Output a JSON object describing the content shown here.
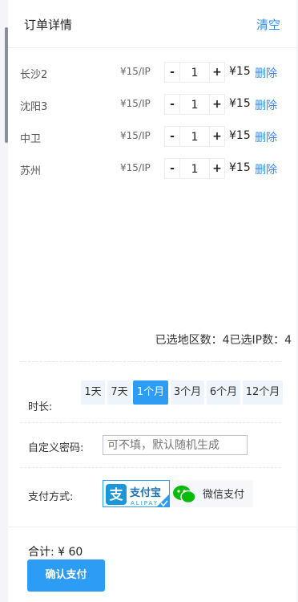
{
  "header": {
    "title": "订单详情",
    "clear_label": "清空"
  },
  "items": [
    {
      "city": "长沙2",
      "unit_price": "¥15/IP",
      "minus": "-",
      "quantity": "1",
      "plus": "+",
      "total": "¥15",
      "delete_label": "删除"
    },
    {
      "city": "沈阳3",
      "unit_price": "¥15/IP",
      "minus": "-",
      "quantity": "1",
      "plus": "+",
      "total": "¥15",
      "delete_label": "删除"
    },
    {
      "city": "中卫",
      "unit_price": "¥15/IP",
      "minus": "-",
      "quantity": "1",
      "plus": "+",
      "total": "¥15",
      "delete_label": "删除"
    },
    {
      "city": "苏州",
      "unit_price": "¥15/IP",
      "minus": "-",
      "quantity": "1",
      "plus": "+",
      "total": "¥15",
      "delete_label": "删除"
    }
  ],
  "summary": "已选地区数：4已选IP数：4",
  "duration": {
    "label": "时长:",
    "options": [
      "1天",
      "7天",
      "1个月",
      "3个月",
      "6个月",
      "12个月"
    ],
    "selected": "1个月"
  },
  "password": {
    "label": "自定义密码:",
    "placeholder": "可不填，默认随机生成"
  },
  "payment": {
    "label": "支付方式:",
    "alipay_char": "支",
    "alipay_name": "支付宝",
    "alipay_sub": "ALIPAY",
    "wechat_name": "微信支付",
    "selected": "alipay"
  },
  "footer": {
    "total": "合计: ¥ 60",
    "confirm_label": "确认支付"
  },
  "colors": {
    "accent": "#2d9cf5",
    "link": "#2d8cf0",
    "wechat_green": "#09bb07"
  }
}
